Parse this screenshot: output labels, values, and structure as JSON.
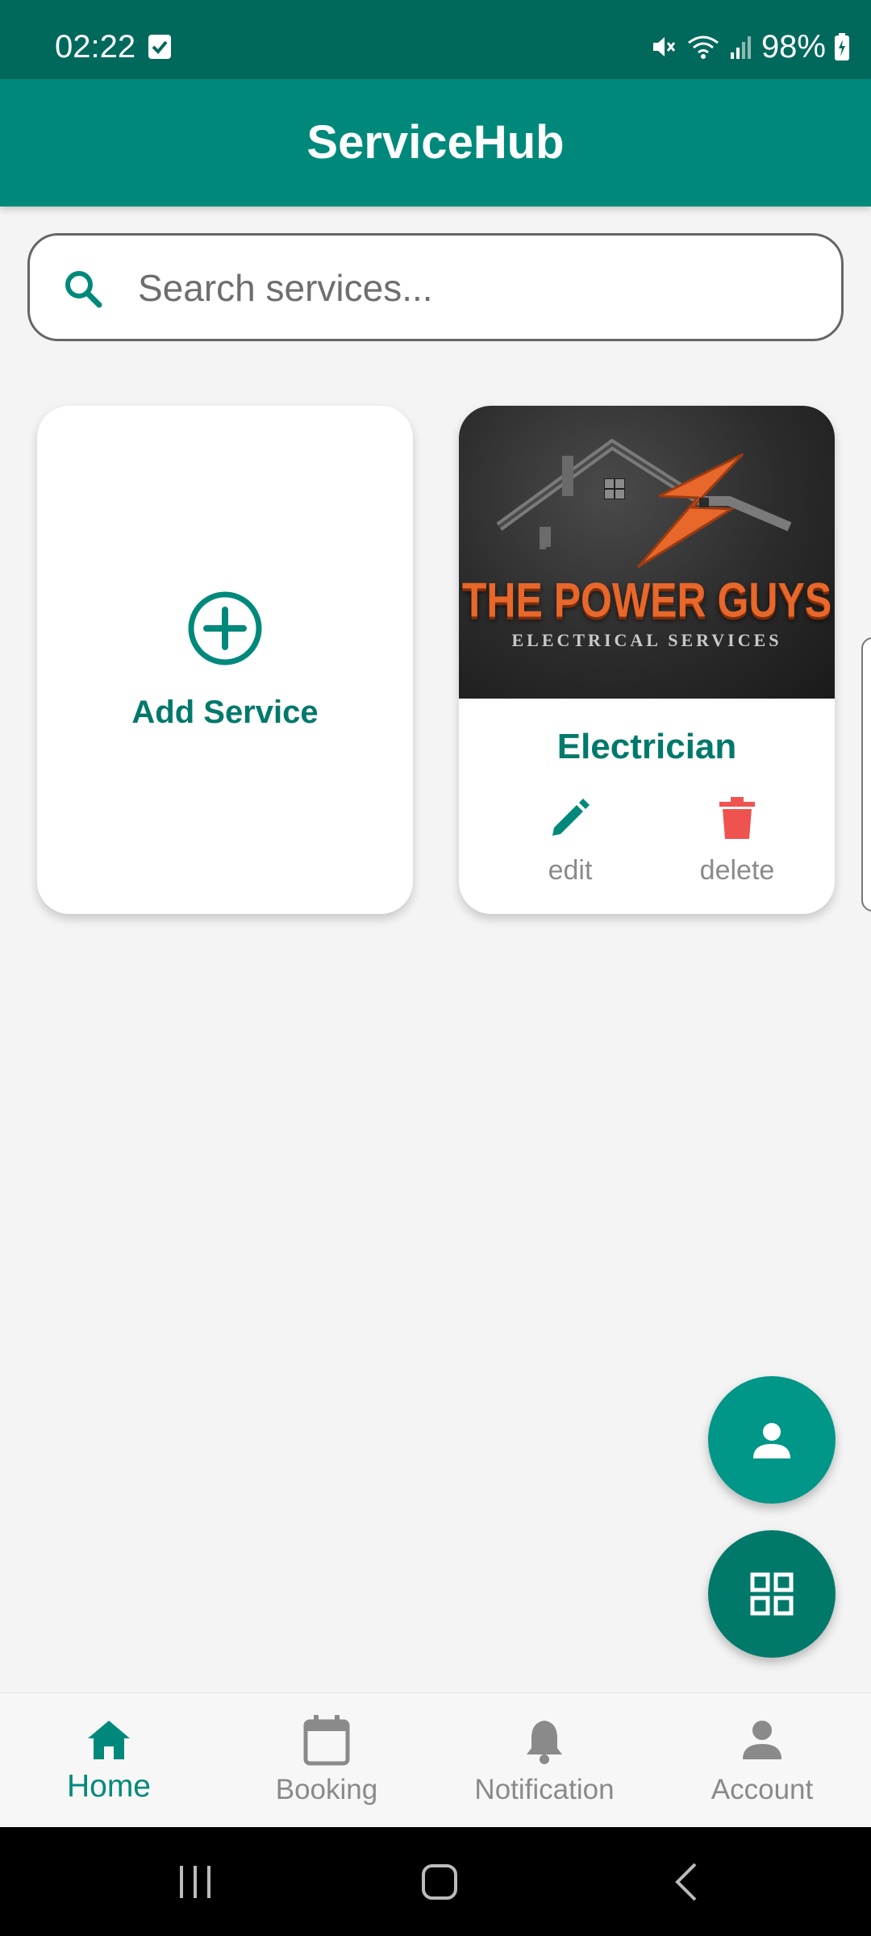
{
  "status_bar": {
    "time": "02:22",
    "battery_percent": "98%",
    "icons": [
      "task-check-icon",
      "mute-icon",
      "wifi-icon",
      "signal-icon",
      "battery-charging-icon"
    ]
  },
  "app_bar": {
    "title": "ServiceHub"
  },
  "search": {
    "placeholder": "Search services...",
    "value": ""
  },
  "cards": {
    "add": {
      "label": "Add Service"
    },
    "service": {
      "logo_text": "THE POWER GUYS",
      "logo_subtext": "ELECTRICAL SERVICES",
      "title": "Electrician",
      "edit_label": "edit",
      "delete_label": "delete"
    }
  },
  "fabs": {
    "account_icon": "person-icon",
    "grid_icon": "grid-icon"
  },
  "bottom_nav": {
    "items": [
      {
        "label": "Home",
        "icon": "home-icon",
        "active": true
      },
      {
        "label": "Booking",
        "icon": "calendar-icon",
        "active": false
      },
      {
        "label": "Notification",
        "icon": "bell-icon",
        "active": false
      },
      {
        "label": "Account",
        "icon": "person-icon",
        "active": false
      }
    ]
  },
  "colors": {
    "status_bar": "#00695c",
    "app_bar": "#00897b",
    "accent": "#00796b",
    "delete": "#ef5350",
    "background": "#f4f4f4"
  }
}
